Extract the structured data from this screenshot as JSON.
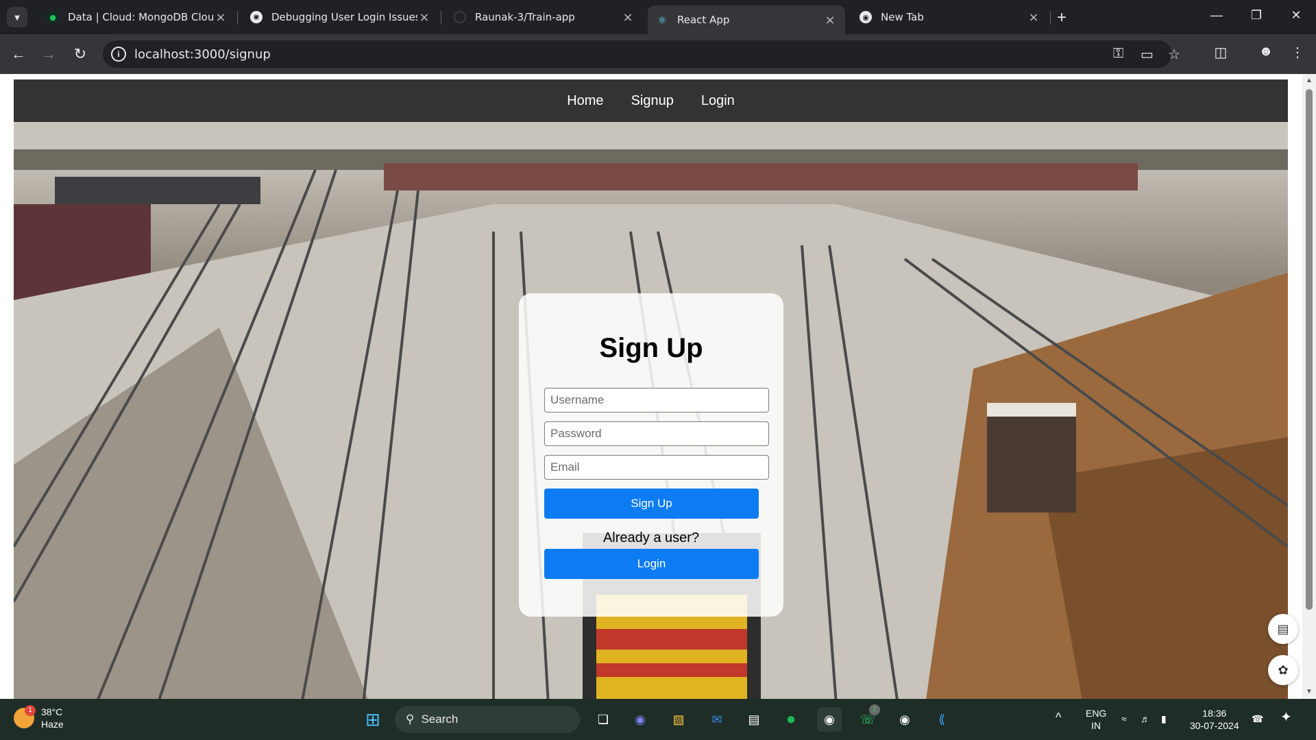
{
  "browser": {
    "tabs": [
      {
        "title": "Data | Cloud: MongoDB Cloud",
        "active": false
      },
      {
        "title": "Debugging User Login Issues",
        "active": false
      },
      {
        "title": "Raunak-3/Train-app",
        "active": false
      },
      {
        "title": "React App",
        "active": true
      },
      {
        "title": "New Tab",
        "active": false
      }
    ],
    "url": "localhost:3000/signup"
  },
  "page": {
    "nav": [
      "Home",
      "Signup",
      "Login"
    ],
    "form": {
      "title": "Sign Up",
      "username_placeholder": "Username",
      "password_placeholder": "Password",
      "email_placeholder": "Email",
      "signup_button": "Sign Up",
      "already_text": "Already a user?",
      "login_button": "Login"
    }
  },
  "taskbar": {
    "weather_temp": "38°C",
    "weather_desc": "Haze",
    "weather_badge": "1",
    "search_label": "Search",
    "lang_primary": "ENG",
    "lang_secondary": "IN",
    "time": "18:36",
    "date": "30-07-2024",
    "whatsapp_badge": "1"
  },
  "colors": {
    "accent_button": "#0d7cf2",
    "navbar_bg": "#333333"
  }
}
